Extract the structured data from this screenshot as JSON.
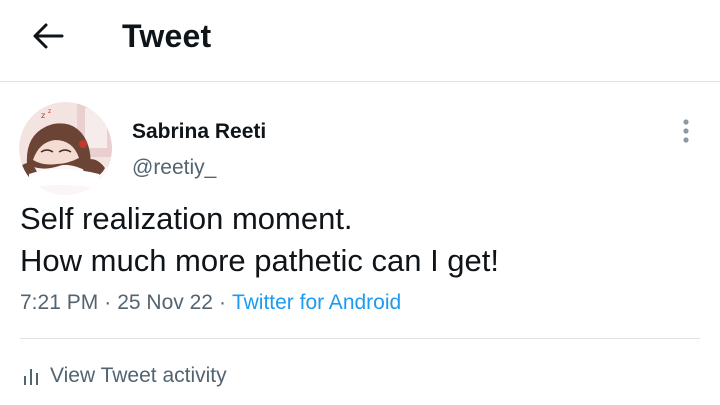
{
  "header": {
    "title": "Tweet",
    "back_icon": "arrow-left-icon"
  },
  "tweet": {
    "author": {
      "display_name": "Sabrina Reeti",
      "handle": "@reetiy_",
      "avatar_icon": "avatar-anime-girl-sleeping"
    },
    "more_icon": "more-vertical-icon",
    "text_lines": [
      "Self realization moment.",
      "How much more pathetic can I get!"
    ],
    "time": "7:21 PM",
    "date": "25 Nov 22",
    "separator": "·",
    "source": "Twitter for Android"
  },
  "activity": {
    "icon": "bar-chart-icon",
    "label": "View Tweet activity"
  },
  "colors": {
    "text_primary": "#0f1419",
    "text_secondary": "#536471",
    "accent": "#1d9bf0",
    "divider": "#dfe3e6"
  }
}
